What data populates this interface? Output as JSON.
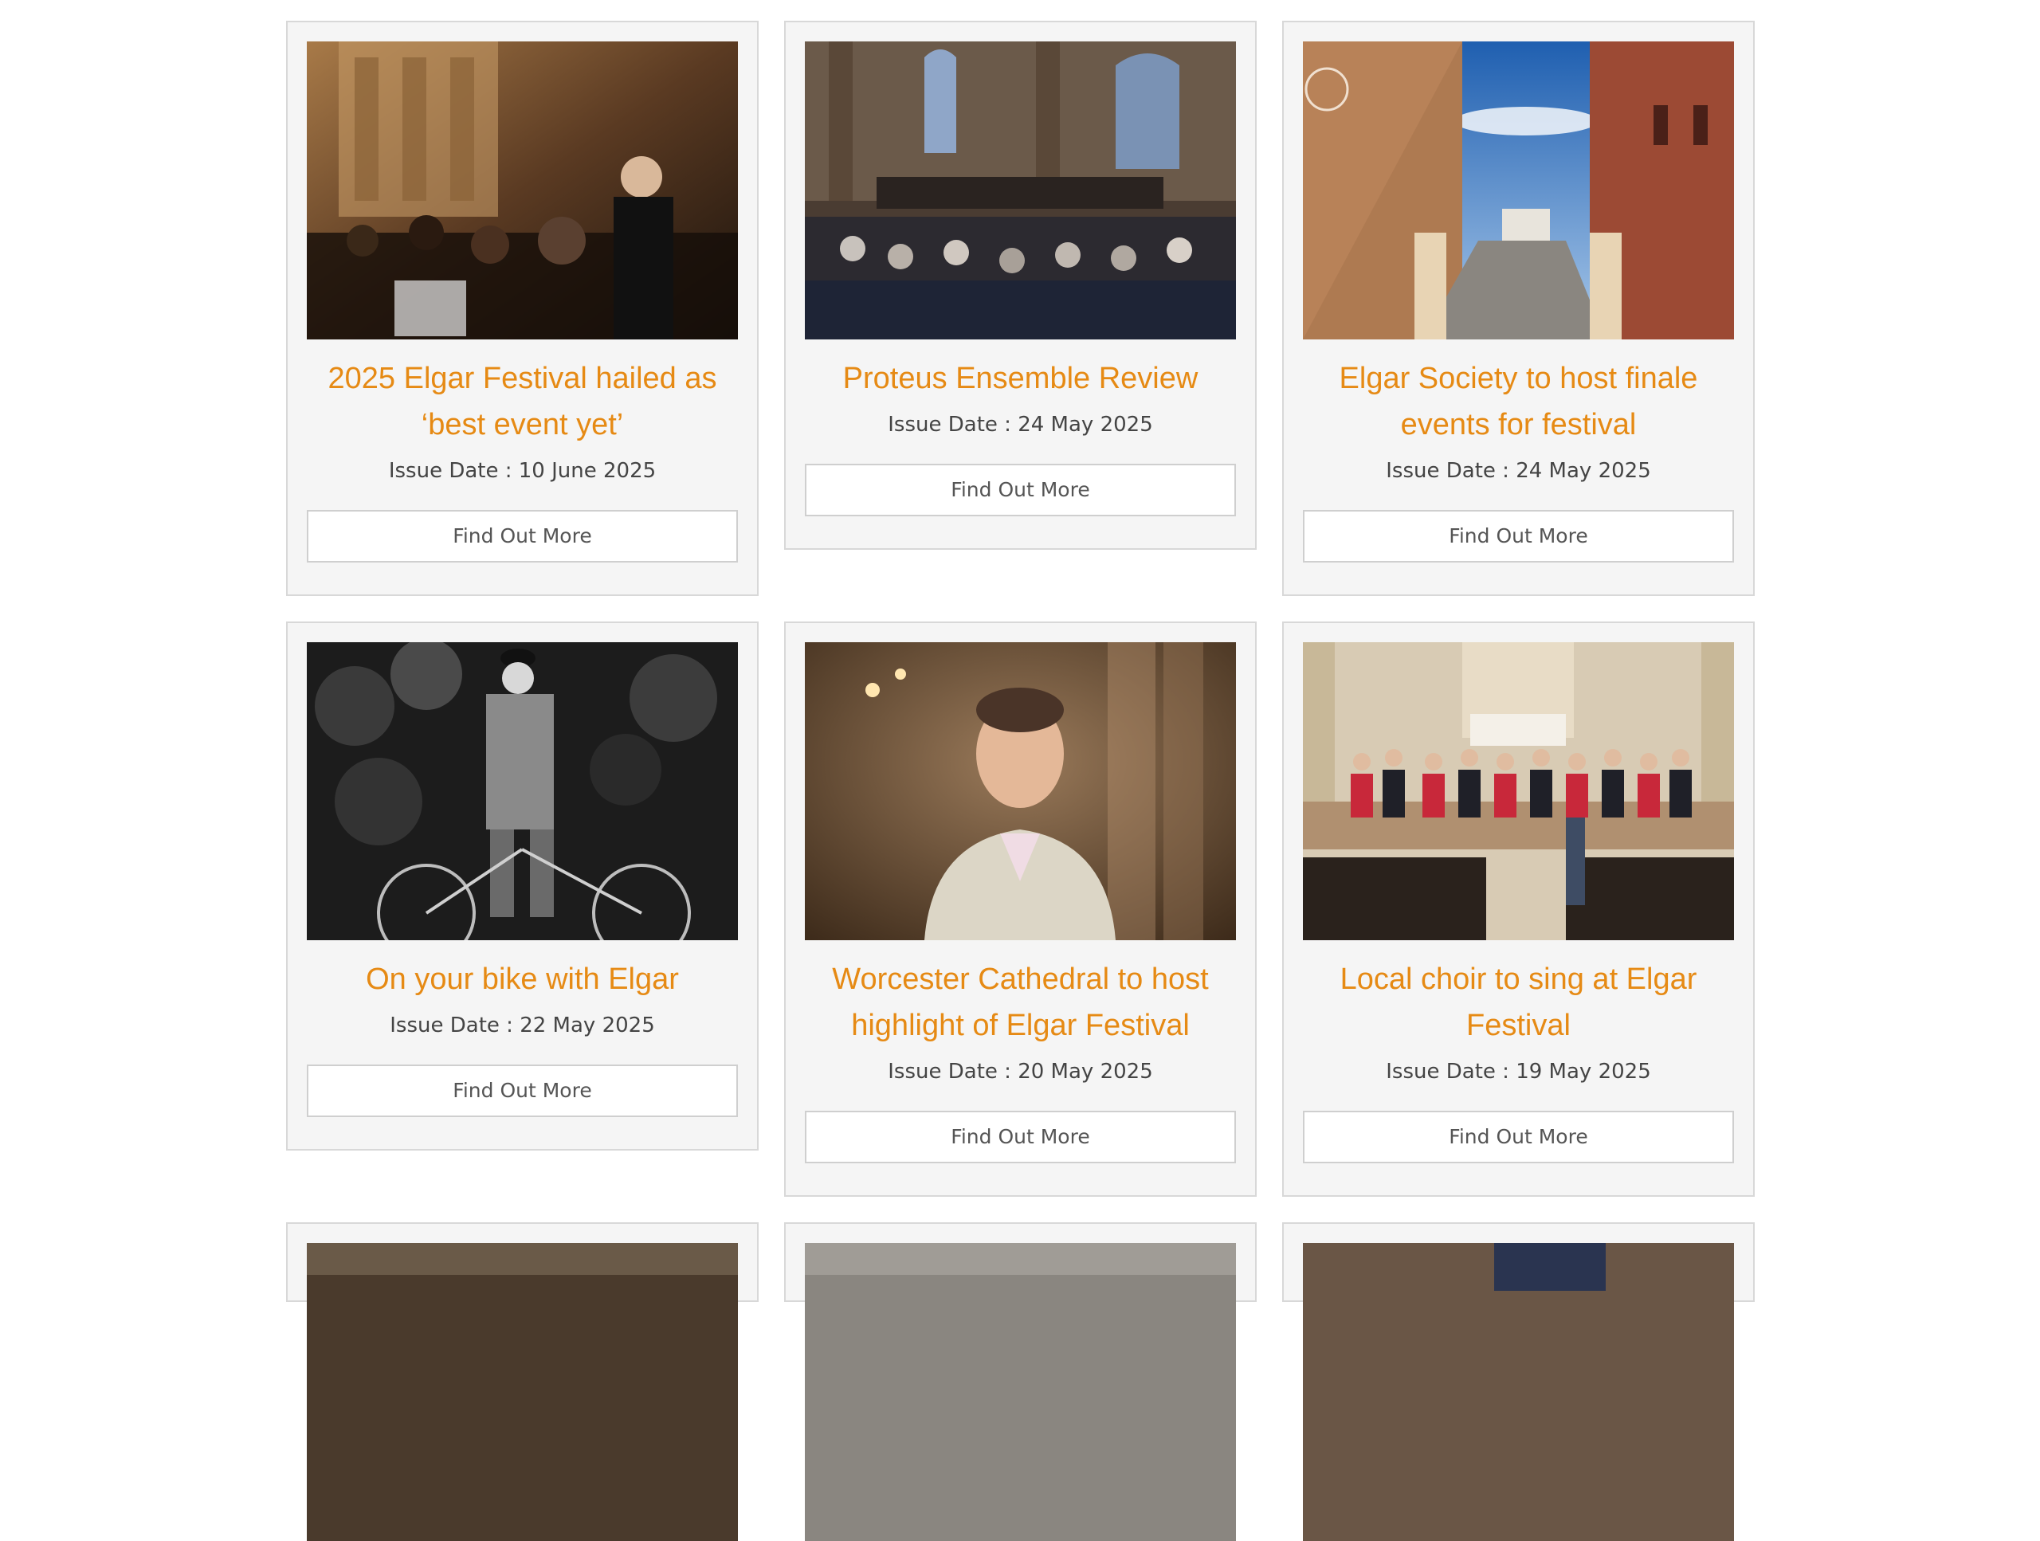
{
  "colors": {
    "title": "#e68a14",
    "card_background": "#f5f5f5",
    "card_border": "#d8d8d8"
  },
  "articles": [
    {
      "title": "2025 Elgar Festival hailed as ‘best event yet’",
      "date": "Issue Date : 10 June 2025",
      "button": "Find Out More",
      "image": "orchestra-conductor-photo"
    },
    {
      "title": "Proteus Ensemble Review",
      "date": "Issue Date : 24 May 2025",
      "button": "Find Out More",
      "image": "church-concert-photo"
    },
    {
      "title": "Elgar Society to host finale events for festival",
      "date": "Issue Date : 24 May 2025",
      "button": "Find Out More",
      "image": "museum-building-photo"
    },
    {
      "title": "On your bike with Elgar",
      "date": "Issue Date : 22 May 2025",
      "button": "Find Out More",
      "image": "elgar-bicycle-photo"
    },
    {
      "title": "Worcester Cathedral to host highlight of Elgar Festival",
      "date": "Issue Date : 20 May 2025",
      "button": "Find Out More",
      "image": "portrait-man-photo"
    },
    {
      "title": "Local choir to sing at Elgar Festival",
      "date": "Issue Date : 19 May 2025",
      "button": "Find Out More",
      "image": "choir-church-photo"
    }
  ]
}
